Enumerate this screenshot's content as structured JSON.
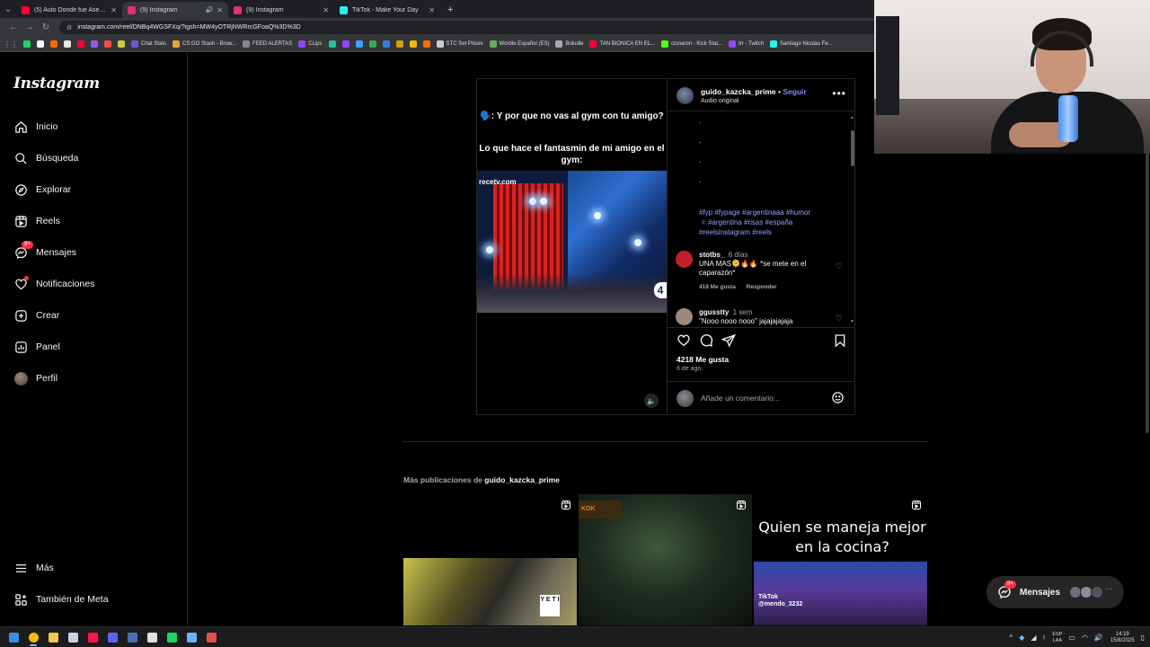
{
  "browser": {
    "tabs": [
      {
        "title": "(5) Auto Donde fue Asesinado",
        "active": false,
        "favicon_color": "#ff0033"
      },
      {
        "title": "(9) Instagram",
        "active": true,
        "favicon_color": "#e1306c"
      },
      {
        "title": "(9) Instagram",
        "active": false,
        "favicon_color": "#e1306c"
      },
      {
        "title": "TikTok - Make Your Day",
        "active": false,
        "favicon_color": "#25f4ee"
      }
    ],
    "url": "instagram.com/reel/DNBq4WGSFXq/?igsh=MW4yOTRjNWRrcGFoaQ%3D%3D",
    "bookmarks": [
      {
        "label": "",
        "color": "#1ed760"
      },
      {
        "label": "",
        "color": "#ffffff"
      },
      {
        "label": "",
        "color": "#ff6a00"
      },
      {
        "label": "",
        "color": "#e8e8e8"
      },
      {
        "label": "",
        "color": "#ff0033"
      },
      {
        "label": "",
        "color": "#8a5cf6"
      },
      {
        "label": "",
        "color": "#f04d4d"
      },
      {
        "label": "",
        "color": "#c9c94a"
      },
      {
        "label": "Chat Stats",
        "color": "#6a5acd"
      },
      {
        "label": "CS:GO Stash - Brow...",
        "color": "#e8a33a"
      },
      {
        "label": "FEED ALERTAS",
        "color": "#888888"
      },
      {
        "label": "CLips",
        "color": "#9146ff"
      },
      {
        "label": "",
        "color": "#25c2a0"
      },
      {
        "label": "",
        "color": "#9146ff"
      },
      {
        "label": "",
        "color": "#3aa0ff"
      },
      {
        "label": "",
        "color": "#34a853"
      },
      {
        "label": "",
        "color": "#3a7bd5"
      },
      {
        "label": "",
        "color": "#d4a017"
      },
      {
        "label": "",
        "color": "#f0b90b"
      },
      {
        "label": "",
        "color": "#ff6a00"
      },
      {
        "label": "STC Set Prices",
        "color": "#cccccc"
      },
      {
        "label": "Wordle Español (ES)",
        "color": "#6aaa64"
      },
      {
        "label": "Boludle",
        "color": "#aaaaaa"
      },
      {
        "label": "TAN BIONICA EN EL...",
        "color": "#ff0033"
      },
      {
        "label": "cionaron - Kick Stat...",
        "color": "#53fc18"
      },
      {
        "label": "trr - Twitch",
        "color": "#9146ff"
      },
      {
        "label": "Santiago Nicolas Fe...",
        "color": "#25f4ee"
      }
    ]
  },
  "sidebar": {
    "logo": "Instagram",
    "items": [
      {
        "label": "Inicio",
        "icon": "home-icon"
      },
      {
        "label": "Búsqueda",
        "icon": "search-icon"
      },
      {
        "label": "Explorar",
        "icon": "compass-icon"
      },
      {
        "label": "Reels",
        "icon": "reels-icon"
      },
      {
        "label": "Mensajes",
        "icon": "messenger-icon",
        "badge": "9+"
      },
      {
        "label": "Notificaciones",
        "icon": "heart-icon",
        "dot": true
      },
      {
        "label": "Crear",
        "icon": "plus-square-icon"
      },
      {
        "label": "Panel",
        "icon": "chart-icon"
      },
      {
        "label": "Perfil",
        "icon": "avatar"
      }
    ],
    "bottom_items": [
      {
        "label": "Más",
        "icon": "menu-icon"
      },
      {
        "label": "También de Meta",
        "icon": "meta-icon"
      }
    ]
  },
  "post": {
    "video_caption_1": "🗣️: Y por que no vas al gym con tu amigo?",
    "video_caption_2": "Lo que hace el fantasmin de mi amigo en el gym:",
    "video_watermark": "recetv.com",
    "video_badge": "4",
    "author": "guido_kazcka_prime",
    "separator": "•",
    "follow_label": "Seguir",
    "audio_label": "Audio original",
    "caption_dots": [
      ".",
      ".",
      ".",
      "."
    ],
    "hashtags": "#fyp #fypage #argentinaaa #humor #️#argentina #risas #españa #reelsinstagram #reels",
    "comments": [
      {
        "user": "stotbs_",
        "time": "6 días",
        "text": "UNA MAS🫠🔥🔥 *se mete en el caparazón*",
        "likes": "418 Me gusta",
        "reply": "Responder",
        "avatar_color": "#c0202a"
      },
      {
        "user": "ggusstty",
        "time": "1 sem",
        "text": "\"Nooo nooo nooo\" jajajajajaja",
        "avatar_color": "#9b8a7a"
      }
    ],
    "likes_count": "4218 Me gusta",
    "date": "6 de ago.",
    "comment_placeholder": "Añade un comentario..."
  },
  "more_posts": {
    "prefix": "Más publicaciones de",
    "author": "guido_kazcka_prime",
    "thumbs": [
      {
        "text": "",
        "overlay": "Y\nE T\nI"
      },
      {
        "text": "",
        "overlay": "KOK"
      },
      {
        "text": "Quien se maneja mejor en la cocina?",
        "overlay": "TikTok\n@mendo_3232"
      }
    ]
  },
  "messages_pill": {
    "label": "Mensajes",
    "badge": "9+",
    "avatar_colors": [
      "#6b6f78",
      "#8a8f99",
      "#50545c"
    ],
    "more": "···"
  },
  "taskbar": {
    "apps": [
      {
        "name": "windows-start",
        "color": "#3a8ee6"
      },
      {
        "name": "chrome",
        "color": "#fbbc05",
        "active": true
      },
      {
        "name": "file-explorer",
        "color": "#f2c94c"
      },
      {
        "name": "steam",
        "color": "#c7d5e0"
      },
      {
        "name": "opera-gx",
        "color": "#ff1744"
      },
      {
        "name": "discord",
        "color": "#5865f2"
      },
      {
        "name": "app-window",
        "color": "#4a6fb5"
      },
      {
        "name": "capcut",
        "color": "#e0e0e0"
      },
      {
        "name": "spotify",
        "color": "#1ed760"
      },
      {
        "name": "app-tool",
        "color": "#69b4ff"
      },
      {
        "name": "streamlabs",
        "color": "#e84b4b"
      }
    ],
    "lang_top": "ESP",
    "lang_bottom": "LAA",
    "time": "14:19",
    "date": "15/8/2025"
  }
}
